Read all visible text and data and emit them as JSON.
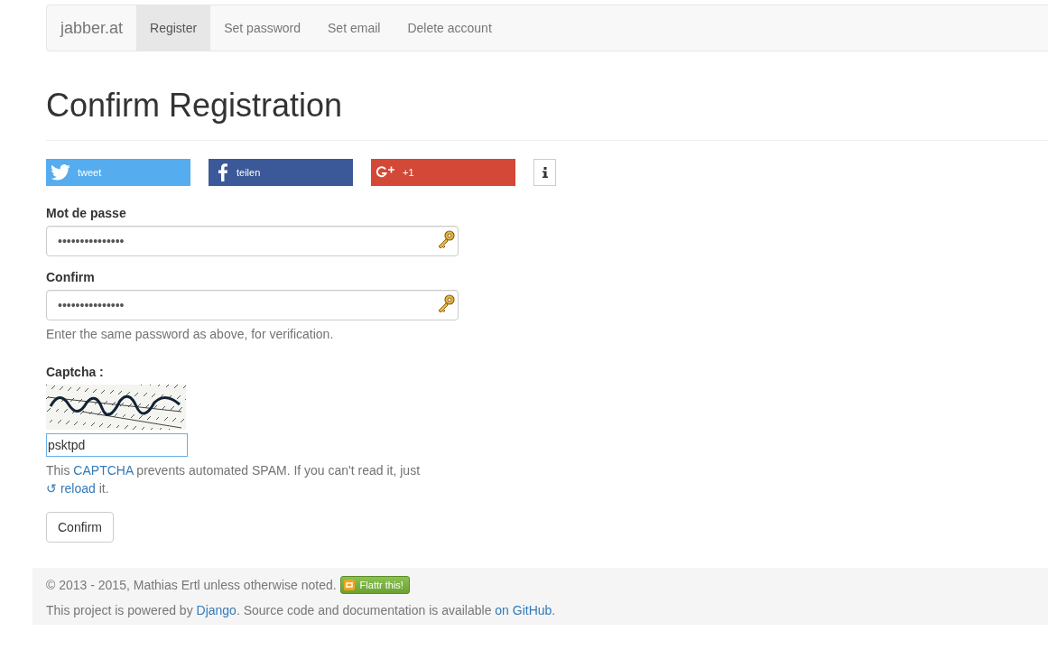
{
  "navbar": {
    "brand": "jabber.at",
    "items": [
      {
        "label": "Register",
        "selected": true
      },
      {
        "label": "Set password",
        "selected": false
      },
      {
        "label": "Set email",
        "selected": false
      },
      {
        "label": "Delete account",
        "selected": false
      }
    ]
  },
  "title": "Confirm Registration",
  "share_buttons": [
    {
      "kind": "twitter",
      "label": "tweet"
    },
    {
      "kind": "facebook",
      "label": "teilen"
    },
    {
      "kind": "googleplus",
      "label": "+1"
    }
  ],
  "fields": [
    {
      "label": "Mot de passe",
      "value": "•••••••••••••••"
    },
    {
      "label": "Confirm",
      "value": "•••••••••••••••",
      "help": "Enter the same password as above, for verification."
    }
  ],
  "captcha": {
    "label": "Captcha :",
    "value": "psktpd",
    "help_before": "This ",
    "help_link": "CAPTCHA",
    "help_after": " prevents automated SPAM. If you can't read it, just",
    "reload_glyph": "↺",
    "reload_link": "reload",
    "reload_after": " it."
  },
  "submit": "Confirm",
  "footer": {
    "copyright": "© 2013 - 2015, Mathias Ertl unless otherwise noted.",
    "flattr": "Flattr this!",
    "powered_before": "This project is powered by ",
    "powered_link": "Django",
    "powered_middle": ". Source code and documentation is available ",
    "powered_link2": "on GitHub",
    "powered_after": "."
  }
}
